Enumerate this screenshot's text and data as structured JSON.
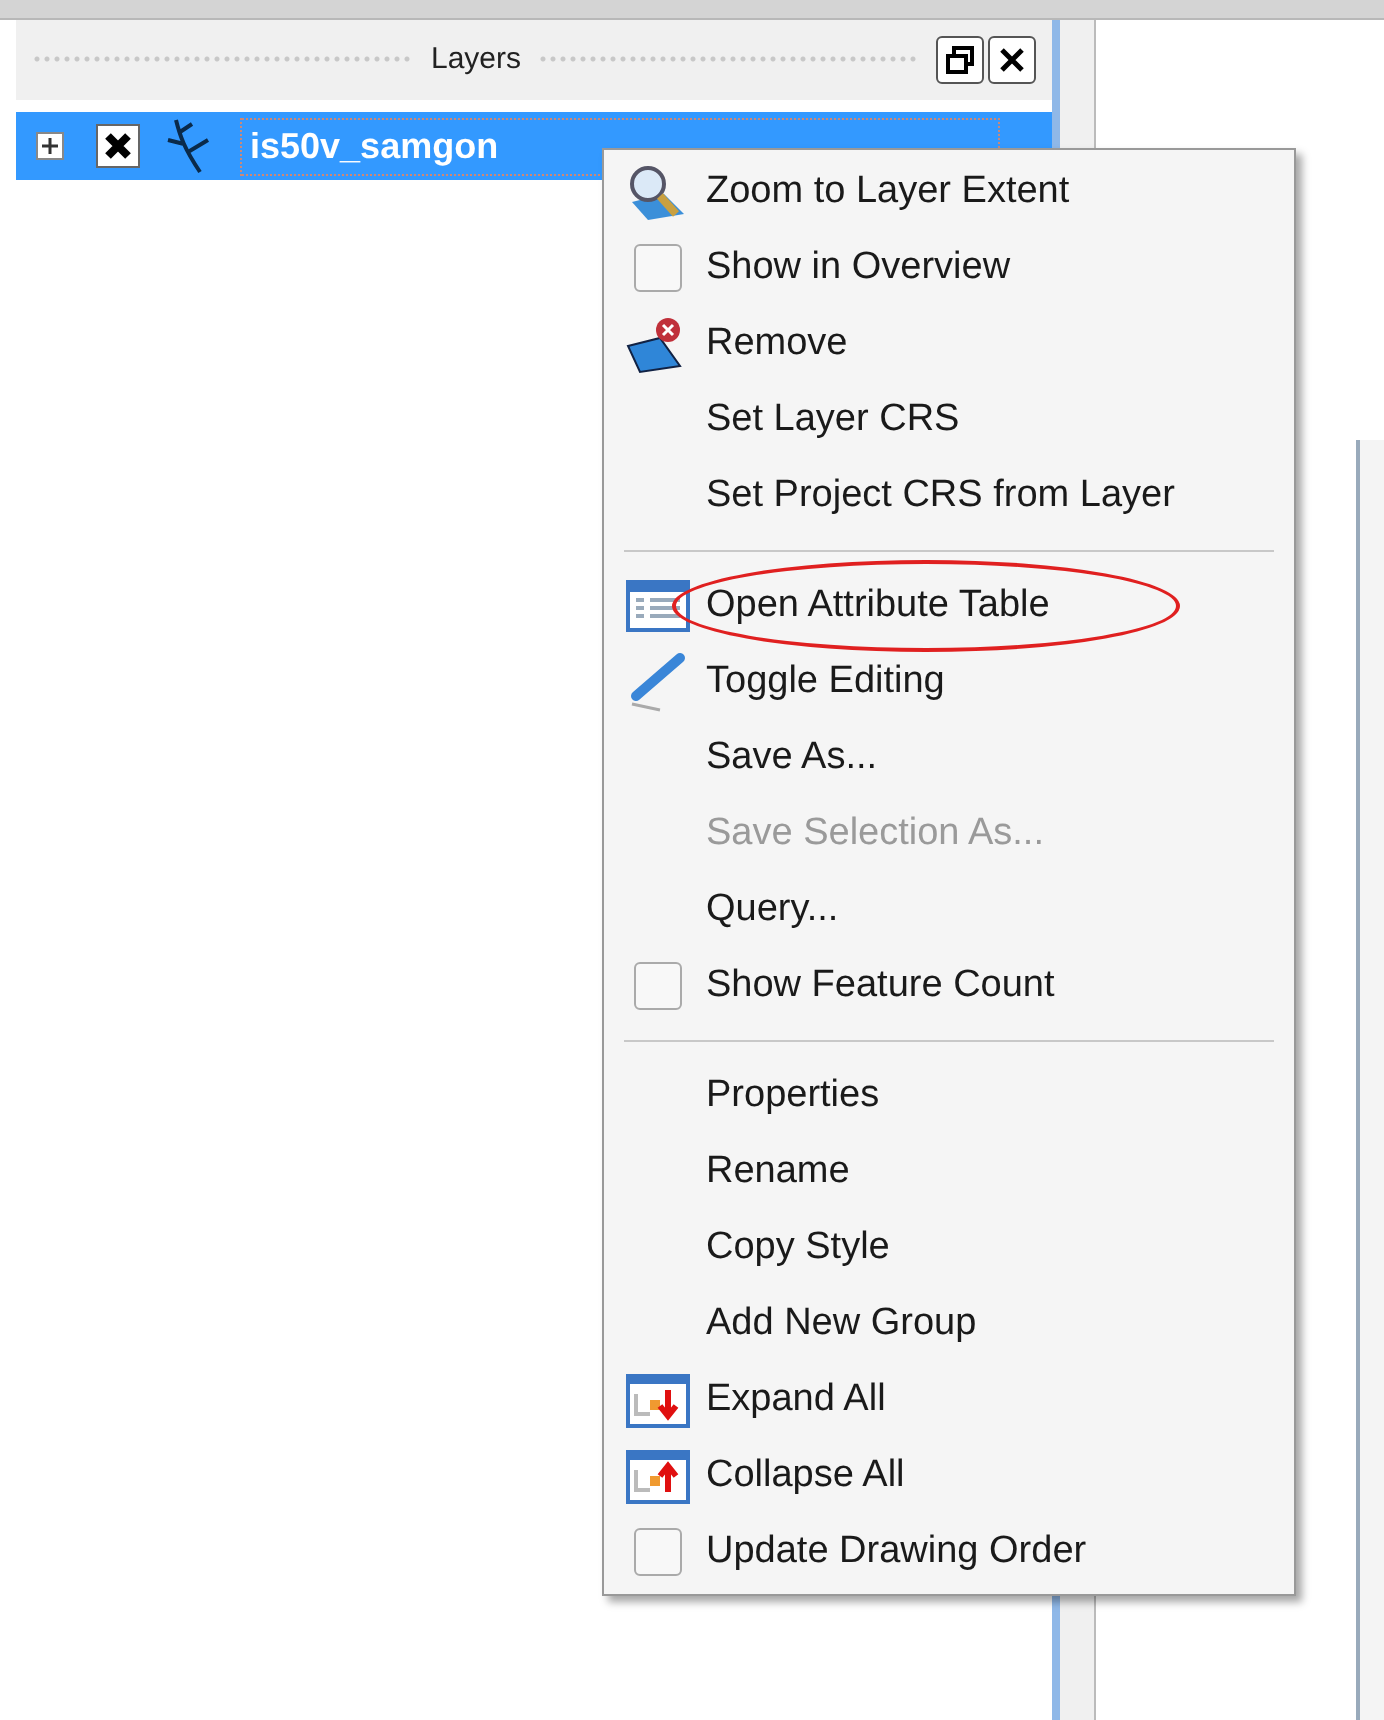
{
  "panel": {
    "title": "Layers",
    "buttons": [
      {
        "kind": "float"
      },
      {
        "kind": "close"
      }
    ]
  },
  "layers": [
    {
      "name": "is50v_samgon",
      "selected": true,
      "expanded": false,
      "visible": true
    }
  ],
  "context_menu": {
    "items": [
      {
        "kind": "zoom",
        "label": "Zoom to Layer Extent"
      },
      {
        "kind": "checkbox",
        "label": "Show in Overview",
        "checked": false
      },
      {
        "kind": "remove",
        "label": "Remove"
      },
      {
        "kind": "plain",
        "label": "Set Layer CRS"
      },
      {
        "kind": "plain",
        "label": "Set Project CRS from Layer"
      },
      {
        "kind": "separator"
      },
      {
        "kind": "table",
        "label": "Open Attribute Table",
        "circled": true
      },
      {
        "kind": "pencil",
        "label": "Toggle Editing"
      },
      {
        "kind": "plain",
        "label": "Save As..."
      },
      {
        "kind": "plain",
        "label": "Save Selection As...",
        "disabled": true
      },
      {
        "kind": "plain",
        "label": "Query..."
      },
      {
        "kind": "checkbox",
        "label": "Show Feature Count",
        "checked": false
      },
      {
        "kind": "separator"
      },
      {
        "kind": "plain",
        "label": "Properties"
      },
      {
        "kind": "plain",
        "label": "Rename"
      },
      {
        "kind": "plain",
        "label": "Copy Style"
      },
      {
        "kind": "plain",
        "label": "Add New Group"
      },
      {
        "kind": "expand",
        "label": "Expand All"
      },
      {
        "kind": "collapse",
        "label": "Collapse All"
      },
      {
        "kind": "checkbox",
        "label": "Update Drawing Order",
        "checked": false
      }
    ]
  }
}
